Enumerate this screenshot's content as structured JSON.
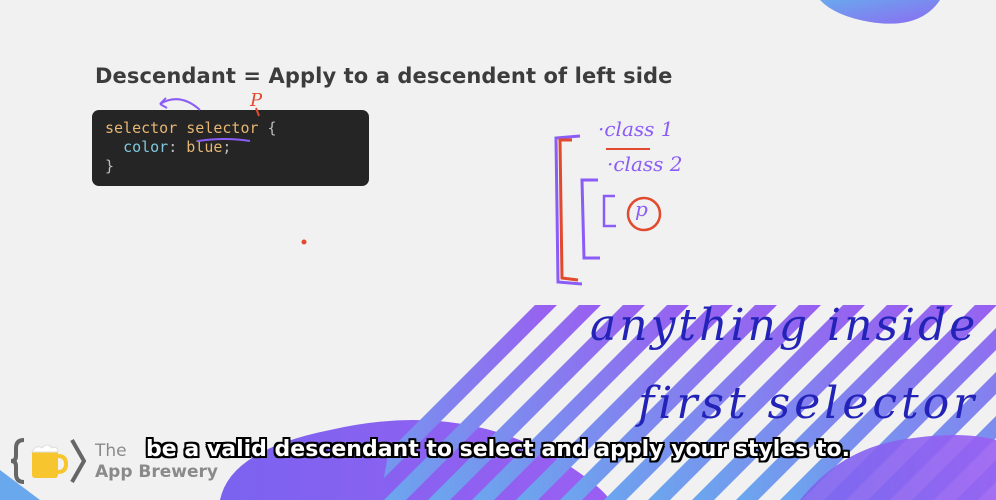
{
  "slide": {
    "heading": "Descendant = Apply to a descendent of left side",
    "code": {
      "line1_sel_a": "selector",
      "line1_sel_b": "selector",
      "line1_brace": " {",
      "line2_prop": "color",
      "line2_colon": ": ",
      "line2_val": "blue",
      "line2_semi": ";",
      "line3": "}"
    }
  },
  "annotations": {
    "class1": "·class 1",
    "class2": "·class 2",
    "p_bubble": "p",
    "p_label": "P",
    "note_line1": "anything inside",
    "note_line2": "first selector"
  },
  "branding": {
    "the": "The",
    "name": "App Brewery"
  },
  "caption": "be a valid descendant to select and apply your styles to.",
  "colors": {
    "background": "#f1f1f1",
    "code_bg": "#252525",
    "purple_ink": "#8b5cf6",
    "red_ink": "#e14a2e",
    "blue_ink": "#2323b8",
    "stripe_blue": "#6aa8ee",
    "stripe_purple": "#9b5cf0"
  },
  "icons": [
    "curly-braces-logo-icon",
    "beer-mug-icon"
  ]
}
